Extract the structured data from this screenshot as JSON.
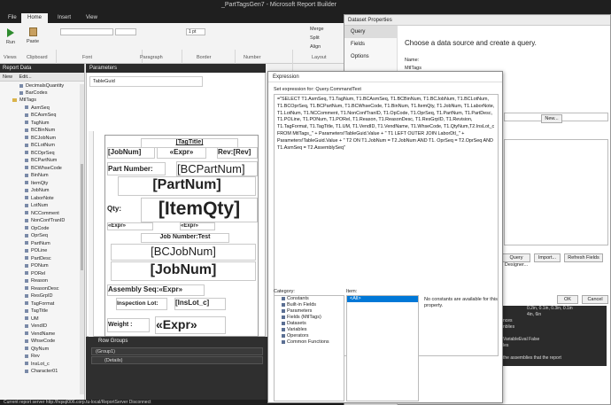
{
  "window": {
    "title": "_PartTagsGen7 - Microsoft Report Builder"
  },
  "tabs": [
    "File",
    "Home",
    "Insert",
    "View"
  ],
  "ribbon": {
    "run": "Run",
    "paste": "Paste",
    "groups": [
      "Views",
      "Clipboard",
      "Font",
      "Paragraph",
      "Border",
      "Number",
      "Layout"
    ],
    "pt_value": "1 pt",
    "merge": "Merge",
    "split": "Split",
    "align": "Align"
  },
  "report_data": {
    "header": "Report Data",
    "tools": [
      "New",
      "Edit..."
    ],
    "items_top": [
      "DecimalsQuantity",
      "BarCodes"
    ],
    "dataset": "MtlTags",
    "fields": [
      "AsmSeq",
      "BCAsmSeq",
      "TagNum",
      "BCBinNum",
      "BCJobNum",
      "BCLotNum",
      "BCOprSeq",
      "BCPartNum",
      "BCWhseCode",
      "BinNum",
      "ItemQty",
      "JobNum",
      "LaborNote",
      "LotNum",
      "NCComment",
      "NonConfTranID",
      "OpCode",
      "OprSeq",
      "PartNum",
      "POLine",
      "PartDesc",
      "PONum",
      "PORel",
      "Reason",
      "ReasonDesc",
      "ResGrpID",
      "TagFormat",
      "TagTitle",
      "UM",
      "VendID",
      "VendName",
      "WhseCode",
      "QtyNum",
      "Rev",
      "InsLot_c",
      "Character01"
    ]
  },
  "parameters": {
    "header": "Parameters",
    "field": "TableGuid"
  },
  "report": {
    "tag_title": "[TagTitle]",
    "job_num_small": "[JobNum]",
    "expr": "«Expr»",
    "rev": "Rev:[Rev]",
    "part_number_label": "Part Number:",
    "bc_part_num": "[BCPartNum]",
    "part_num": "[PartNum]",
    "qty_label": "Qty:",
    "item_qty": "[ItemQty]",
    "expr_left": "«Expr»",
    "expr_right": "«Expr»",
    "job_number_test": "Job Number:Test",
    "bc_job_num": "[BCJobNum]",
    "job_num": "[JobNum]",
    "assembly_seq": "Assembly Seq:«Expr»",
    "inspection_lot": "Inspection Lot:",
    "ins_lot": "[InsLot_c]",
    "weight": "Weight :",
    "weight_expr": "«Expr»"
  },
  "row_groups": {
    "header": "Row Groups",
    "group": "(Group1)",
    "details": "(Details)"
  },
  "status_bar": "Current report server http://hqsql006.corp.tu-local/ReportServer   Disconnect",
  "dataset_properties": {
    "title": "Dataset Properties",
    "nav": [
      "Query",
      "Fields",
      "Options"
    ],
    "intro": "Choose a data source and create a query.",
    "name_label": "Name:",
    "name_value": "MtlTags",
    "new_button": "New...",
    "designer_button": "Query Designer...",
    "import_button": "Import...",
    "refresh_button": "Refresh Fields",
    "ok_button": "OK",
    "cancel_button": "Cancel",
    "size_1": "0.2in, 0.1in, 0.3in, 0.1in",
    "size_2": "4in, 6in",
    "grid_rows": [
      "nces",
      "nblies",
      "",
      "VariableEval  False",
      "les",
      "",
      "the assemblies that the report"
    ]
  },
  "expression": {
    "title": "Expression",
    "set_for": "Set expression for: Query.CommandText",
    "text": "=\"SELECT T1.AsmSeq, T1.TagNum, T1.BCAsmSeq, T1.BCBinNum, T1.BCJobNum, T1.BCLotNum, T1.BCOprSeq, T1.BCPartNum, T1.BCWhseCode, T1.BinNum, T1.ItemQty, T1.JobNum, T1.LaborNote, T1.LotNum, T1.NCComment, T1.NonConfTranID, T1.OpCode, T1.OprSeq, T1.PartNum, T1.PartDesc, T1.POLine, T1.PONum, T1.PORel, T1.Reason, T1.ReasonDesc, T1.ResGrpID, T1.Revision, T1.TagFormat, T1.TagTitle, T1.UM, T1.VendID, T1.VendName, T1.WhseCode, T1.QtyNum,T2.InsLot_c FROM MtlTags_\" + Parameters!TableGuid.Value + \" T1 LEFT OUTER JOIN LaborDtl_\" + Parameters!TableGuid.Value + \" T2 ON T1.JobNum = T2.JobNum AND T1. OprSeq = T2.OprSeq AND T1.AsmSeq = T2.AssemblySeq\"",
    "category_label": "Category:",
    "item_label": "Item:",
    "categories": [
      "Constants",
      "Built-in Fields",
      "Parameters",
      "Fields (MtlTags)",
      "Datasets",
      "Variables",
      "Operators",
      "Common Functions"
    ],
    "selected_item": "<All>",
    "description": "No constants are available for this property."
  }
}
